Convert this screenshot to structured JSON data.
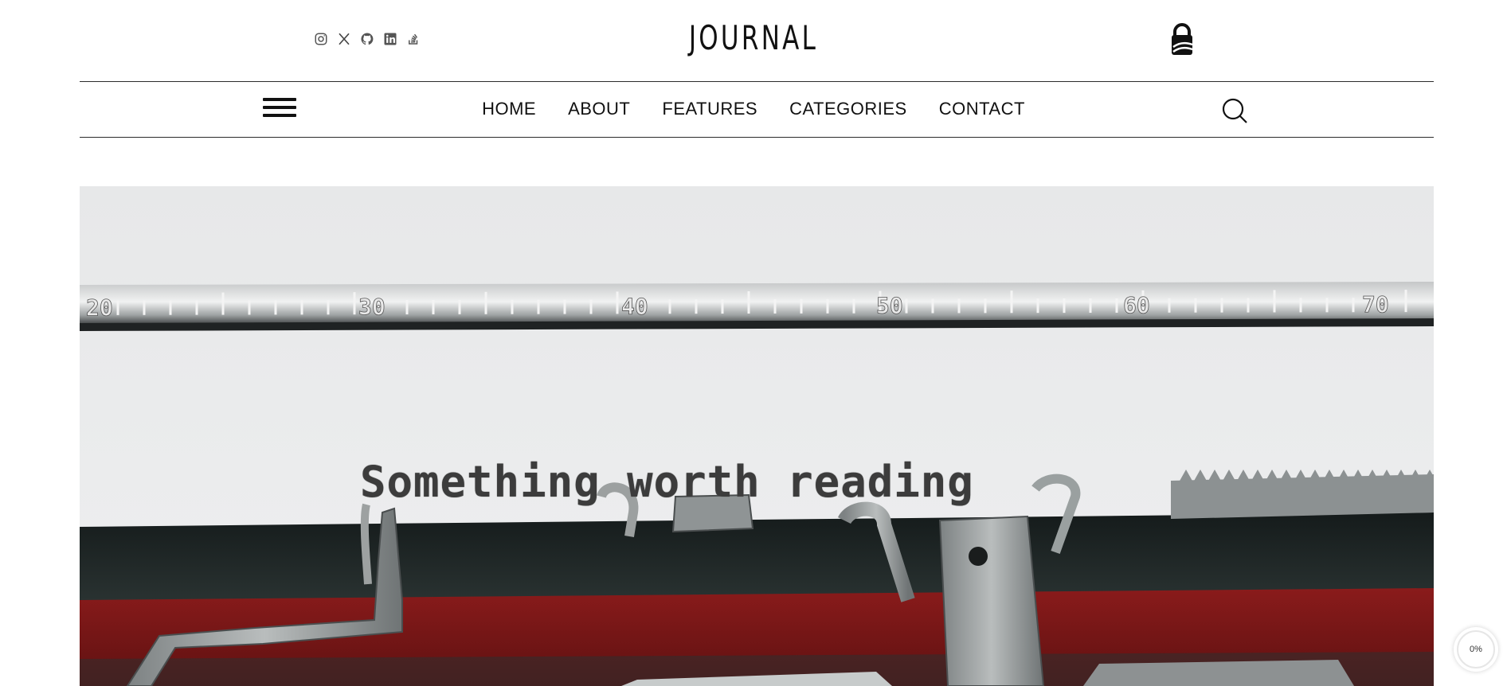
{
  "header": {
    "logo": "JOURNAL",
    "socials": [
      {
        "icon": "instagram-icon"
      },
      {
        "icon": "x-twitter-icon"
      },
      {
        "icon": "github-icon"
      },
      {
        "icon": "linkedin-icon"
      },
      {
        "icon": "stackoverflow-icon"
      }
    ],
    "account_icon": "padlock-user-icon"
  },
  "nav": {
    "menu_icon": "hamburger-menu-icon",
    "items": [
      "HOME",
      "ABOUT",
      "FEATURES",
      "CATEGORIES",
      "CONTACT"
    ],
    "search_icon": "search-icon"
  },
  "hero": {
    "typed_text": "Something worth reading",
    "ruler_numbers": [
      "20",
      "30",
      "40",
      "50",
      "60",
      "70"
    ],
    "colors": {
      "ribbon_black": "#1e2424",
      "ribbon_red": "#7a1616",
      "paper": "#e9eaeb",
      "metal": "#8d9191"
    }
  },
  "reading_progress": {
    "label": "0%",
    "value": 0
  },
  "colors": {
    "text": "#111111",
    "rule": "#2b2b2b",
    "background": "#ffffff"
  }
}
